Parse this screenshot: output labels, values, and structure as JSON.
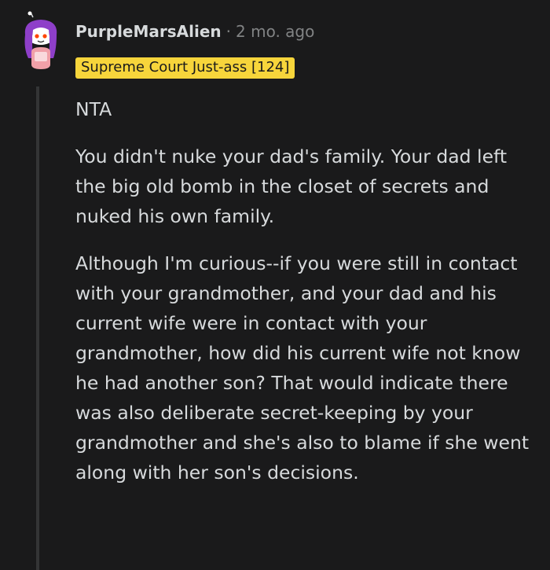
{
  "comment": {
    "username": "PurpleMarsAlien",
    "separator": "·",
    "timestamp": "2 mo. ago",
    "flair": "Supreme Court Just-ass [124]",
    "paragraphs": [
      "NTA",
      "You didn't nuke your dad's family. Your dad left the big old bomb in the closet of secrets and nuked his own family.",
      "Although I'm curious--if you were still in contact with your grandmother, and your dad and his current wife were in contact with your grandmother, how did his current wife not know he had another son? That would indicate there was also deliberate secret-keeping by your grandmother and she's also to blame if she went along with her son's decisions."
    ]
  },
  "colors": {
    "background": "#1a1a1b",
    "text": "#d7dadc",
    "meta": "#818384",
    "flair_bg": "#f7d53b",
    "avatar_hair": "#8e3fc9",
    "thread_line": "#343536"
  },
  "icons": {
    "avatar": "snoo-avatar-icon"
  }
}
